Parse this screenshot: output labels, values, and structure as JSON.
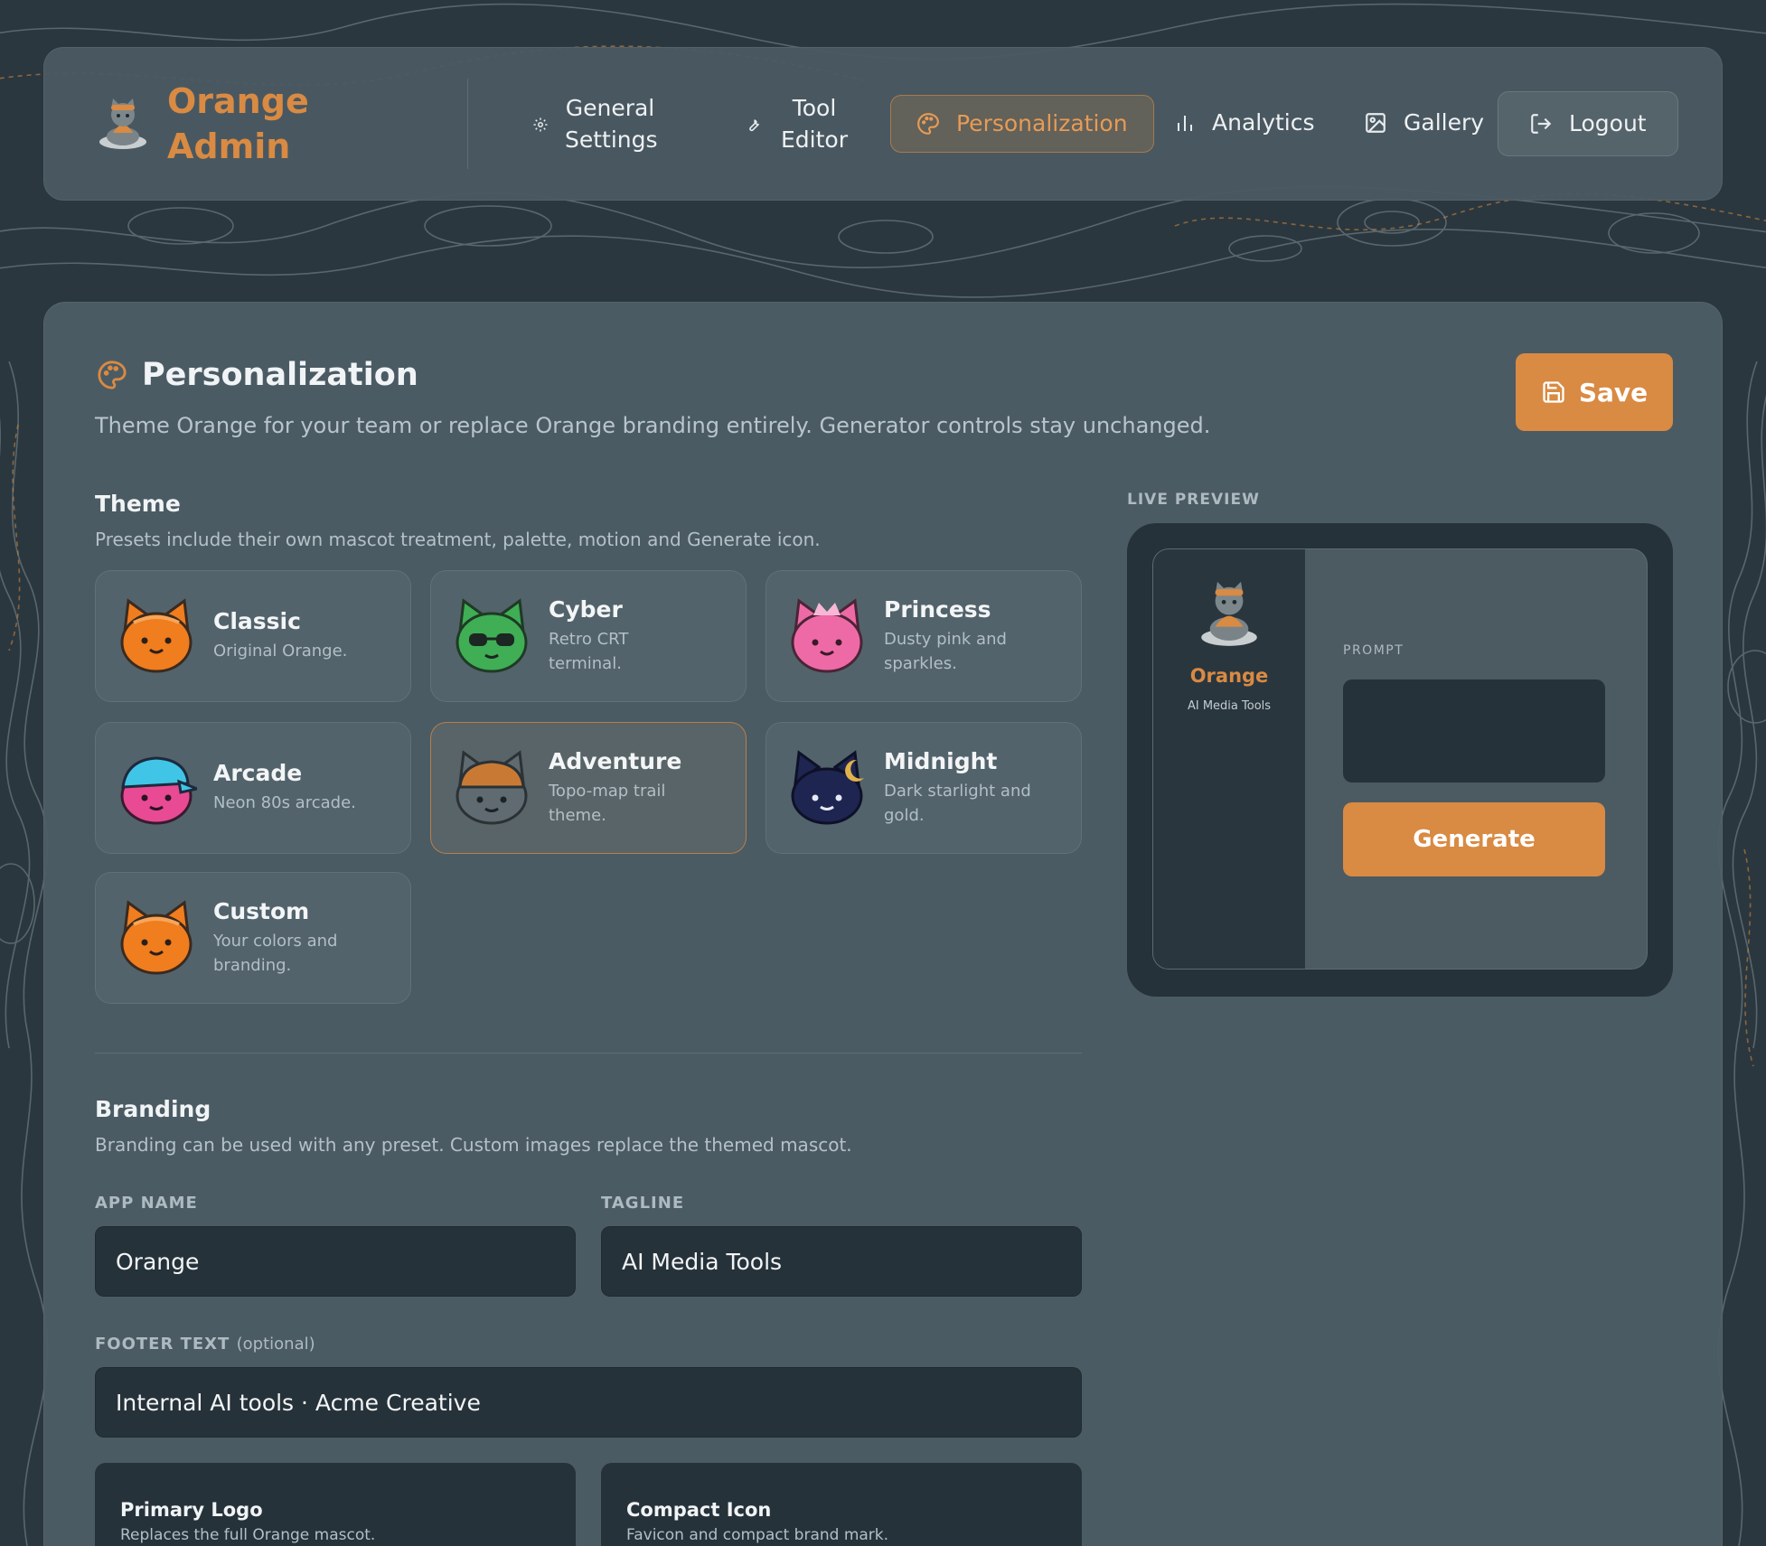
{
  "nav": {
    "brand": "Orange Admin",
    "items": [
      {
        "label": "General Settings",
        "icon": "gear-icon"
      },
      {
        "label": "Tool Editor",
        "icon": "wrench-icon"
      },
      {
        "label": "Personalization",
        "icon": "palette-icon",
        "active": true
      },
      {
        "label": "Analytics",
        "icon": "bar-chart-icon"
      },
      {
        "label": "Gallery",
        "icon": "image-icon"
      }
    ],
    "logout": "Logout"
  },
  "page": {
    "title": "Personalization",
    "description": "Theme Orange for your team or replace Orange branding entirely. Generator controls stay unchanged.",
    "save_label": "Save"
  },
  "theme": {
    "title": "Theme",
    "description": "Presets include their own mascot treatment, palette, motion and Generate icon.",
    "presets": [
      {
        "name": "Classic",
        "desc": "Original Orange.",
        "color": "#f07d1e"
      },
      {
        "name": "Cyber",
        "desc": "Retro CRT terminal.",
        "color": "#3fae55"
      },
      {
        "name": "Princess",
        "desc": "Dusty pink and sparkles.",
        "color": "#ee6aa7"
      },
      {
        "name": "Arcade",
        "desc": "Neon 80s arcade.",
        "color": "#e94a94"
      },
      {
        "name": "Adventure",
        "desc": "Topo-map trail theme.",
        "color": "#5f6b70",
        "selected": true
      },
      {
        "name": "Midnight",
        "desc": "Dark starlight and gold.",
        "color": "#1e2550"
      },
      {
        "name": "Custom",
        "desc": "Your colors and branding.",
        "color": "#f07d1e"
      }
    ]
  },
  "branding": {
    "title": "Branding",
    "description": "Branding can be used with any preset. Custom images replace the themed mascot.",
    "app_name_label": "APP NAME",
    "app_name_value": "Orange",
    "tagline_label": "TAGLINE",
    "tagline_value": "AI Media Tools",
    "footer_label": "FOOTER TEXT",
    "footer_optional": "(optional)",
    "footer_value": "Internal AI tools · Acme Creative",
    "primary_logo_title": "Primary Logo",
    "primary_logo_desc": "Replaces the full Orange mascot.",
    "compact_icon_title": "Compact Icon",
    "compact_icon_desc": "Favicon and compact brand mark."
  },
  "preview": {
    "label": "LIVE PREVIEW",
    "app_name": "Orange",
    "tagline": "AI Media Tools",
    "prompt_label": "PROMPT",
    "generate_label": "Generate"
  },
  "colors": {
    "accent": "#d98a43",
    "background": "#2b373e",
    "panel": "#4e5e66",
    "input": "#26323a"
  }
}
